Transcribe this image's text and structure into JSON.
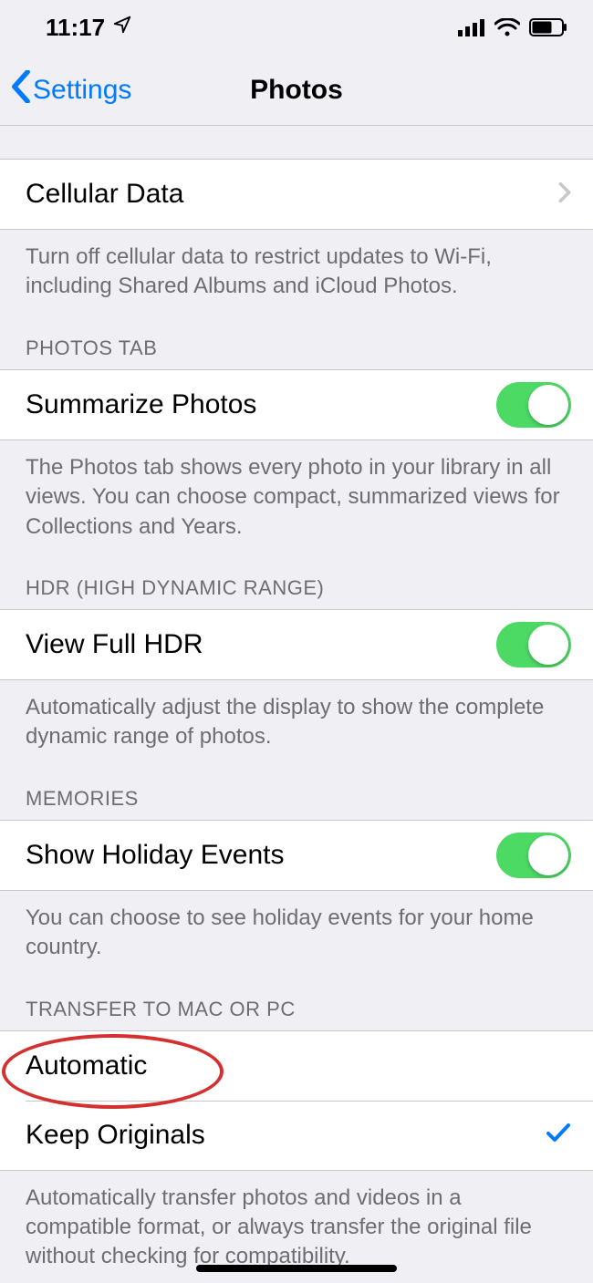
{
  "status": {
    "time": "11:17",
    "location_icon": "location-arrow",
    "signal_bars": 4,
    "wifi": true,
    "battery_pct": 65
  },
  "nav": {
    "back_label": "Settings",
    "title": "Photos"
  },
  "sections": {
    "cellular": {
      "row_label": "Cellular Data",
      "footer": "Turn off cellular data to restrict updates to Wi-Fi, including Shared Albums and iCloud Photos."
    },
    "photos_tab": {
      "header": "PHOTOS TAB",
      "row_label": "Summarize Photos",
      "toggle_on": true,
      "footer": "The Photos tab shows every photo in your library in all views. You can choose compact, summarized views for Collections and Years."
    },
    "hdr": {
      "header": "HDR (HIGH DYNAMIC RANGE)",
      "row_label": "View Full HDR",
      "toggle_on": true,
      "footer": "Automatically adjust the display to show the complete dynamic range of photos."
    },
    "memories": {
      "header": "MEMORIES",
      "row_label": "Show Holiday Events",
      "toggle_on": true,
      "footer": "You can choose to see holiday events for your home country."
    },
    "transfer": {
      "header": "TRANSFER TO MAC OR PC",
      "option_auto": "Automatic",
      "option_keep": "Keep Originals",
      "selected": "keep",
      "footer": "Automatically transfer photos and videos in a compatible format, or always transfer the original file without checking for compatibility."
    }
  },
  "annotation": {
    "target": "keep-originals-row",
    "shape": "oval",
    "color": "#d4302f"
  }
}
